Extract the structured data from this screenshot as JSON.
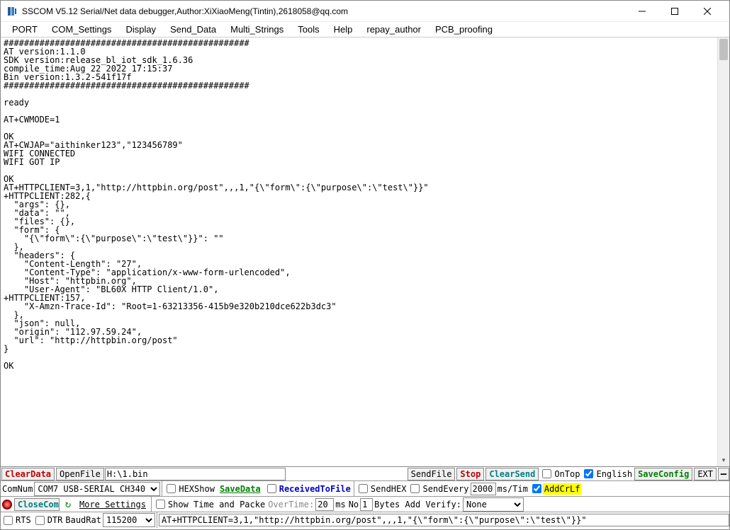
{
  "window": {
    "title": "SSCOM V5.12 Serial/Net data debugger,Author:XiXiaoMeng(Tintin),2618058@qq.com"
  },
  "menu": {
    "items": [
      "PORT",
      "COM_Settings",
      "Display",
      "Send_Data",
      "Multi_Strings",
      "Tools",
      "Help",
      "repay_author",
      "PCB_proofing"
    ]
  },
  "terminal_text": "################################################\nAT version:1.1.0\nSDK version:release_bl_iot_sdk_1.6.36\ncompile_time:Aug 22 2022 17:15:37\nBin version:1.3.2-541f17f\n################################################\n\nready\n\nAT+CWMODE=1\n\nOK\nAT+CWJAP=\"aithinker123\",\"123456789\"\nWIFI CONNECTED\nWIFI GOT IP\n\nOK\nAT+HTTPCLIENT=3,1,\"http://httpbin.org/post\",,,1,\"{\\\"form\\\":{\\\"purpose\\\":\\\"test\\\"}}\"\n+HTTPCLIENT:282,{\n  \"args\": {}, \n  \"data\": \"\", \n  \"files\": {}, \n  \"form\": {\n    \"{\\\"form\\\":{\\\"purpose\\\":\\\"test\\\"}}\": \"\"\n  }, \n  \"headers\": {\n    \"Content-Length\": \"27\", \n    \"Content-Type\": \"application/x-www-form-urlencoded\", \n    \"Host\": \"httpbin.org\", \n    \"User-Agent\": \"BL60X HTTP Client/1.0\", \n+HTTPCLIENT:157,\n    \"X-Amzn-Trace-Id\": \"Root=1-63213356-415b9e320b210dce622b3dc3\"\n  }, \n  \"json\": null, \n  \"origin\": \"112.97.59.24\", \n  \"url\": \"http://httpbin.org/post\"\n}\n\nOK",
  "row1": {
    "clear_data": "ClearData",
    "open_file": "OpenFile",
    "file_path": "H:\\1.bin",
    "send_file": "SendFile",
    "stop": "Stop",
    "clear_send": "ClearSend",
    "ontop": "OnTop",
    "english": "English",
    "save_config": "SaveConfig",
    "ext": "EXT"
  },
  "row2": {
    "comnum_lbl": "ComNum",
    "com_port": "COM7 USB-SERIAL CH340",
    "hexshow": "HEXShow",
    "save_data": "SaveData",
    "recv_to_file": "ReceivedToFile",
    "send_hex": "SendHEX",
    "send_every": "SendEvery",
    "period": "2000",
    "ms_tim": "ms/Tim",
    "addcrlf": "AddCrLf"
  },
  "row3": {
    "close_com": "CloseCom",
    "more_settings": "More Settings",
    "show_time": "Show Time and Packe",
    "overtime": "OverTime:",
    "overtime_val": "20",
    "ms": "ms",
    "no_lbl": "No",
    "no_val": "1",
    "bytes_verify": "Bytes Add Verify:",
    "verify_sel": "None"
  },
  "row4": {
    "rts": "RTS",
    "dtr": "DTR",
    "baudrate_lbl": "BaudRat",
    "baudrate": "115200",
    "send_text": "AT+HTTPCLIENT=3,1,\"http://httpbin.org/post\",,,1,\"{\\\"form\\\":{\\\"purpose\\\":\\\"test\\\"}}\""
  }
}
